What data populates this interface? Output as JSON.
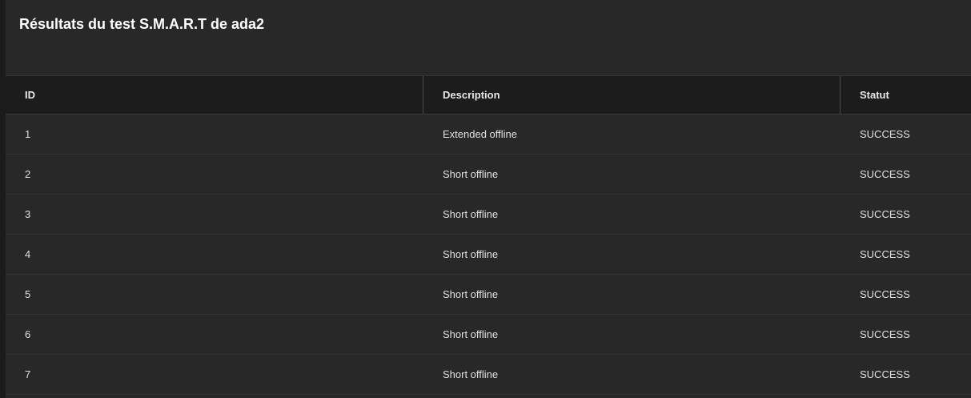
{
  "card": {
    "title": "Résultats du test S.M.A.R.T de ada2"
  },
  "table": {
    "headers": {
      "id": "ID",
      "description": "Description",
      "status": "Statut"
    },
    "rows": [
      {
        "id": "1",
        "description": "Extended offline",
        "status": "SUCCESS"
      },
      {
        "id": "2",
        "description": "Short offline",
        "status": "SUCCESS"
      },
      {
        "id": "3",
        "description": "Short offline",
        "status": "SUCCESS"
      },
      {
        "id": "4",
        "description": "Short offline",
        "status": "SUCCESS"
      },
      {
        "id": "5",
        "description": "Short offline",
        "status": "SUCCESS"
      },
      {
        "id": "6",
        "description": "Short offline",
        "status": "SUCCESS"
      },
      {
        "id": "7",
        "description": "Short offline",
        "status": "SUCCESS"
      }
    ]
  },
  "colors": {
    "background": "#1b1b1b",
    "card": "#282828",
    "header_row": "#1c1c1c",
    "text": "#e0e0e0"
  }
}
